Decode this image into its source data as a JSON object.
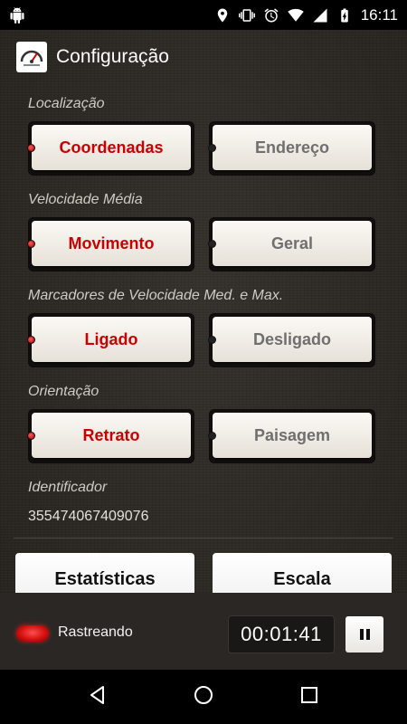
{
  "status_bar": {
    "time": "16:11",
    "icons": [
      "android-debug-icon",
      "location-icon",
      "vibrate-icon",
      "alarm-icon",
      "wifi-icon",
      "signal-icon",
      "battery-icon"
    ]
  },
  "app_bar": {
    "title": "Configuração",
    "logo": "speedometer-logo"
  },
  "sections": [
    {
      "label": "Localização",
      "options": [
        {
          "label": "Coordenadas",
          "active": true
        },
        {
          "label": "Endereço",
          "active": false
        }
      ]
    },
    {
      "label": "Velocidade Média",
      "options": [
        {
          "label": "Movimento",
          "active": true
        },
        {
          "label": "Geral",
          "active": false
        }
      ]
    },
    {
      "label": "Marcadores de Velocidade Med. e Max.",
      "options": [
        {
          "label": "Ligado",
          "active": true
        },
        {
          "label": "Desligado",
          "active": false
        }
      ]
    },
    {
      "label": "Orientação",
      "options": [
        {
          "label": "Retrato",
          "active": true
        },
        {
          "label": "Paisagem",
          "active": false
        }
      ]
    }
  ],
  "identifier": {
    "label": "Identificador",
    "value": "355474067409076"
  },
  "bottom_buttons": {
    "stats_label": "Estatísticas",
    "scale_label": "Escala"
  },
  "tracking": {
    "label": "Rastreando",
    "timer": "00:01:41"
  },
  "colors": {
    "active_text": "#cc0000",
    "inactive_text": "#6f6f6f",
    "led_on": "#e01010"
  }
}
